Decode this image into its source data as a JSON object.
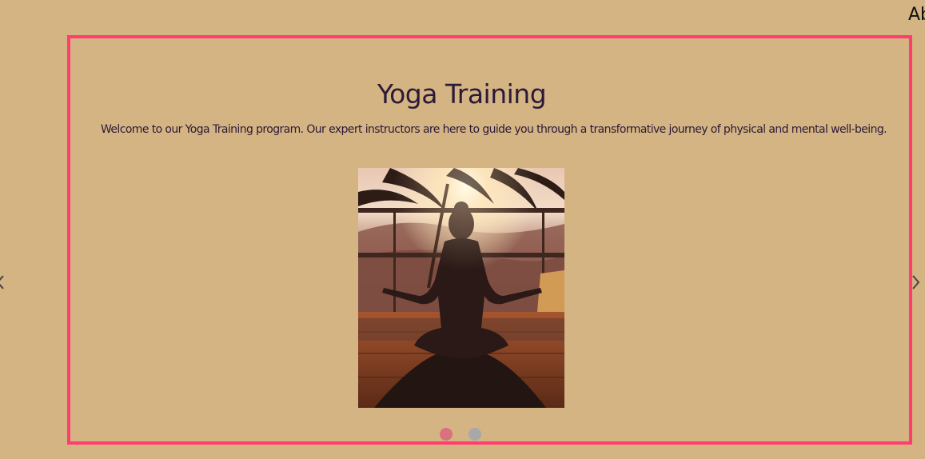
{
  "header": {
    "nav_peek_label": "Ab"
  },
  "carousel": {
    "slide": {
      "title": "Yoga Training",
      "description": "Welcome to our Yoga Training program. Our expert instructors are here to guide you through a transformative journey of physical and mental well-being.",
      "image_semantic": "woman-meditating-lotus-pose-sunset-photo"
    },
    "indicators": [
      {
        "active": true
      },
      {
        "active": false
      }
    ],
    "prev_icon": "chevron-left-icon",
    "next_icon": "chevron-right-icon"
  },
  "colors": {
    "background": "#d4b483",
    "card_border": "#ff3d6e",
    "text": "#2c1a38",
    "indicator_active": "#d9717e",
    "indicator_inactive": "#a8a8a8"
  }
}
